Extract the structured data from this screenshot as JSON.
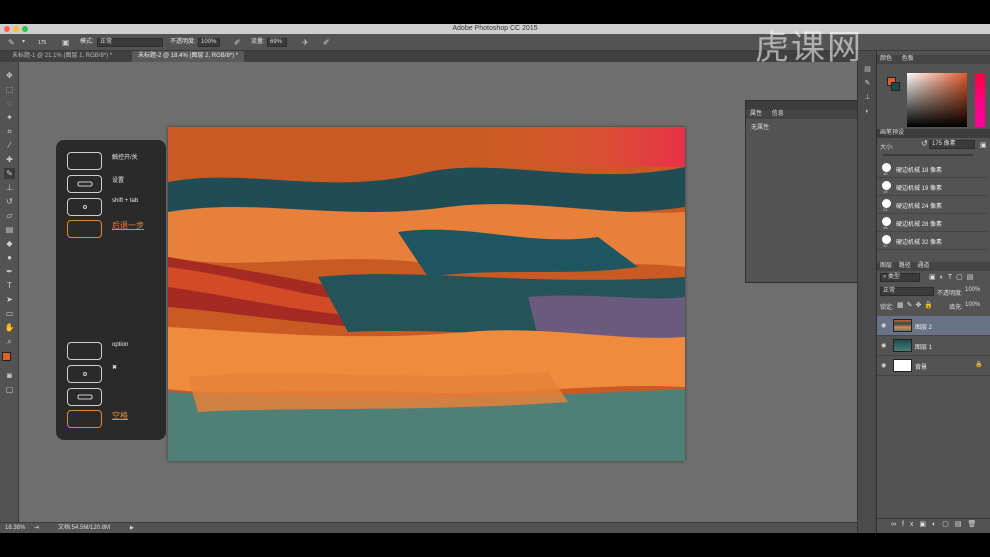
{
  "app": {
    "title": "Adobe Photoshop CC 2015"
  },
  "options_bar": {
    "brush_size": "175",
    "mode_label": "模式:",
    "mode_value": "正常",
    "opacity_label": "不透明度:",
    "opacity_value": "100%",
    "flow_label": "流量:",
    "flow_value": "69%"
  },
  "tabs": [
    {
      "label": "未标题-1 @ 21.1% (图层 1, RGB/8*) *"
    },
    {
      "label": "未标题-2 @ 18.4% (图层 2, RGB/8*) *"
    }
  ],
  "shortcut_panel": {
    "items": [
      {
        "label": "触控开/关"
      },
      {
        "label": "设置"
      },
      {
        "label": "shift + tab"
      },
      {
        "label": "后退一步"
      },
      {
        "label": "option"
      },
      {
        "label": "✖"
      },
      {
        "label": ""
      },
      {
        "label": "空格"
      }
    ]
  },
  "properties_panel": {
    "tab1": "属性",
    "tab2": "信息",
    "body": "无属性"
  },
  "color_panel": {
    "tab1": "颜色",
    "tab2": "色板",
    "fg_color": "#e0602a",
    "bg_color": "#1e4b52"
  },
  "brush_presets": {
    "title": "画笔预设",
    "size_label": "大小:",
    "size_value": "175 像素",
    "items": [
      {
        "num": "18",
        "name": "硬边机械 18 像素"
      },
      {
        "num": "19",
        "name": "硬边机械 19 像素"
      },
      {
        "num": "24",
        "name": "硬边机械 24 像素"
      },
      {
        "num": "28",
        "name": "硬边机械 28 像素"
      },
      {
        "num": "32",
        "name": "硬边机械 32 像素"
      }
    ]
  },
  "layers_panel": {
    "tab1": "图层",
    "tab2": "路径",
    "tab3": "通道",
    "filter_label": "类型",
    "blend_mode": "正常",
    "opacity_label": "不透明度:",
    "opacity_value": "100%",
    "lock_label": "锁定:",
    "fill_label": "填充:",
    "fill_value": "100%",
    "layers": [
      {
        "name": "图层 2"
      },
      {
        "name": "图层 1"
      },
      {
        "name": "背景"
      }
    ]
  },
  "status_bar": {
    "zoom": "18.38%",
    "doc_info": "文档:54.5M/120.8M"
  },
  "watermark": "虎课网",
  "accent": "#e0883a"
}
